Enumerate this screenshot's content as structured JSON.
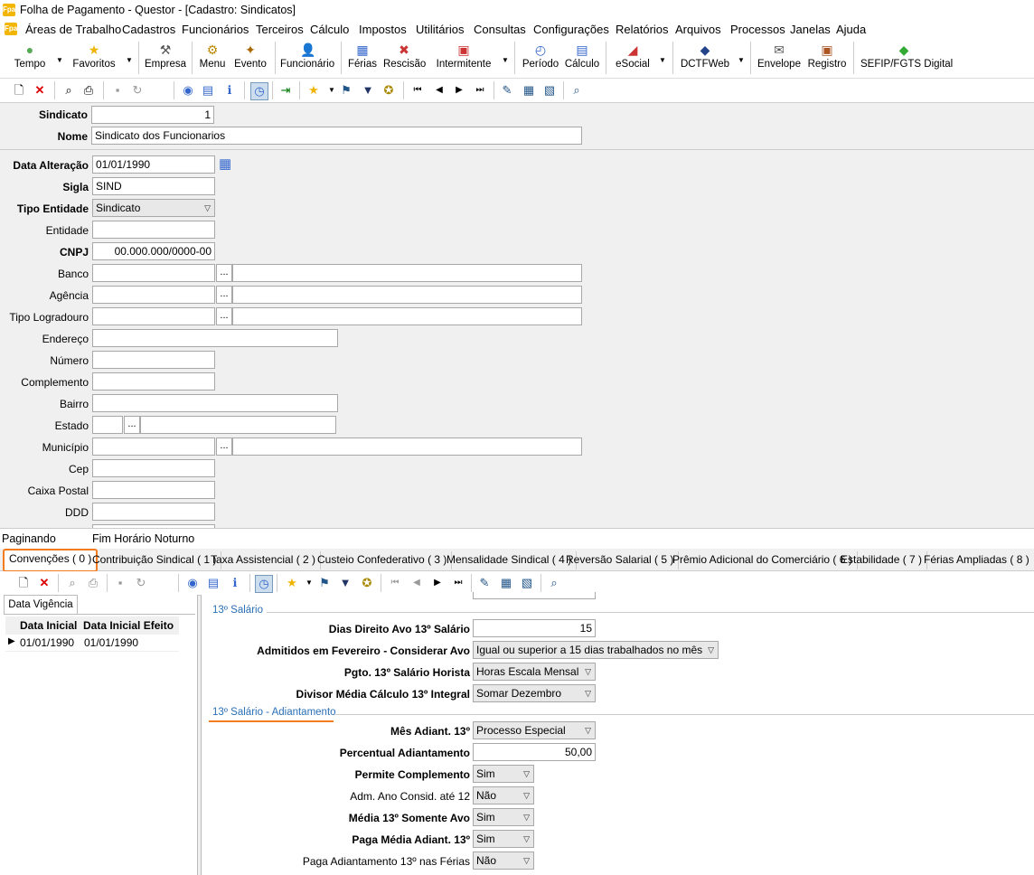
{
  "window": {
    "title": "Folha de Pagamento - Questor - [Cadastro: Sindicatos]"
  },
  "menu": [
    "Áreas de Trabalho",
    "Cadastros",
    "Funcionários",
    "Terceiros",
    "Cálculo",
    "Impostos",
    "Utilitários",
    "Consultas",
    "Configurações",
    "Relatórios",
    "Arquivos",
    "Processos",
    "Janelas",
    "Ajuda"
  ],
  "toolbar": [
    "Tempo",
    "Favoritos",
    "Empresa",
    "Menu",
    "Evento",
    "Funcionário",
    "Férias",
    "Rescisão",
    "Intermitente",
    "Período",
    "Cálculo",
    "eSocial",
    "DCTFWeb",
    "Envelope",
    "Registro",
    "SEFIP/FGTS Digital"
  ],
  "form": {
    "sindicato_label": "Sindicato",
    "sindicato_value": "1",
    "nome_label": "Nome",
    "nome_value": "Sindicato dos Funcionarios",
    "data_alteracao_label": "Data Alteração",
    "data_alteracao_value": "01/01/1990",
    "sigla_label": "Sigla",
    "sigla_value": "SIND",
    "tipo_entidade_label": "Tipo Entidade",
    "tipo_entidade_value": "Sindicato",
    "entidade_label": "Entidade",
    "cnpj_label": "CNPJ",
    "cnpj_value": "00.000.000/0000-00",
    "banco_label": "Banco",
    "agencia_label": "Agência",
    "tipo_logradouro_label": "Tipo Logradouro",
    "endereco_label": "Endereço",
    "numero_label": "Número",
    "complemento_label": "Complemento",
    "bairro_label": "Bairro",
    "estado_label": "Estado",
    "municipio_label": "Município",
    "cep_label": "Cep",
    "caixa_postal_label": "Caixa Postal",
    "ddd_label": "DDD",
    "dots": "..."
  },
  "section_labels": {
    "paginando": "Paginando",
    "fim_horario": "Fim Horário Noturno"
  },
  "tabs": [
    {
      "label": "Convenções ( 0 )"
    },
    {
      "label": "Contribuição Sindical ( 1 )"
    },
    {
      "label": "Taxa Assistencial ( 2 )"
    },
    {
      "label": "Custeio Confederativo ( 3 )"
    },
    {
      "label": "Mensalidade Sindical ( 4 )"
    },
    {
      "label": "Reversão Salarial ( 5 )"
    },
    {
      "label": "Prêmio Adicional do Comerciário ( 6 )"
    },
    {
      "label": "Estabilidade ( 7 )"
    },
    {
      "label": "Férias Ampliadas ( 8 )"
    }
  ],
  "vigencia": {
    "tab_label": "Data Vigência",
    "col1": "Data Inicial",
    "col2": "Data Inicial Efeito",
    "row_marker": "▶",
    "row": {
      "data_inicial": "01/01/1990",
      "data_inicial_efeito": "01/01/1990"
    }
  },
  "decimo": {
    "group1_title": "13º Salário",
    "dias_label": "Dias Direito Avo 13º Salário",
    "dias_value": "15",
    "admitidos_label": "Admitidos em Fevereiro - Considerar Avo",
    "admitidos_value": "Igual ou superior a 15 dias trabalhados no mês",
    "pgto_label": "Pgto. 13º Salário Horista",
    "pgto_value": "Horas Escala Mensal",
    "divisor_label": "Divisor Média Cálculo 13º Integral",
    "divisor_value": "Somar Dezembro",
    "group2_title": "13º Salário - Adiantamento",
    "mes_label": "Mês Adiant. 13º",
    "mes_value": "Processo Especial",
    "percentual_label": "Percentual Adiantamento",
    "percentual_value": "50,00",
    "permite_label": "Permite Complemento",
    "permite_value": "Sim",
    "adm_label": "Adm. Ano Consid. até 12",
    "adm_value": "Não",
    "media_label": "Média 13º Somente Avo",
    "media_value": "Sim",
    "paga_media_label": "Paga Média Adiant. 13º",
    "paga_media_value": "Sim",
    "paga_ferias_label": "Paga Adiantamento 13º nas Férias",
    "paga_ferias_value": "Não"
  }
}
